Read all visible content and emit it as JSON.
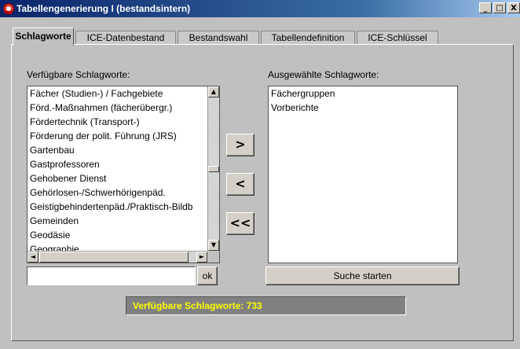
{
  "window": {
    "title": "Tabellengenerierung I (bestandsintern)",
    "minimize": "_",
    "maximize": "□",
    "close": "X"
  },
  "tabs": [
    {
      "label": "Schlagworte",
      "active": true
    },
    {
      "label": "ICE-Datenbestand",
      "active": false
    },
    {
      "label": "Bestandswahl",
      "active": false
    },
    {
      "label": "Tabellendefinition",
      "active": false
    },
    {
      "label": "ICE-Schlüssel",
      "active": false
    }
  ],
  "available": {
    "label": "Verfügbare Schlagworte:",
    "items": [
      "Fächer (Studien-) / Fachgebiete",
      "Förd.-Maßnahmen (fächerübergr.)",
      "Fördertechnik (Transport-)",
      "Förderung der polit. Führung (JRS)",
      "Gartenbau",
      "Gastprofessoren",
      "Gehobener Dienst",
      "Gehörlosen-/Schwerhörigenpäd.",
      "Geistigbehindertenpäd./Praktisch-Bildb",
      "Gemeinden",
      "Geodäsie",
      "Geographie"
    ],
    "scroll_position": 0.5
  },
  "selected": {
    "label": "Ausgewählte Schlagworte:",
    "items": [
      "Fächergruppen",
      "Vorberichte"
    ]
  },
  "buttons": {
    "add": ">",
    "remove": "<",
    "remove_all": "<<",
    "ok": "ok",
    "search": "Suche starten"
  },
  "search_input": {
    "value": ""
  },
  "status": "Verfügbare Schlagworte: 733",
  "icons": {
    "scroll_up": "▲",
    "scroll_down": "▼",
    "scroll_left": "◄",
    "scroll_right": "►"
  }
}
